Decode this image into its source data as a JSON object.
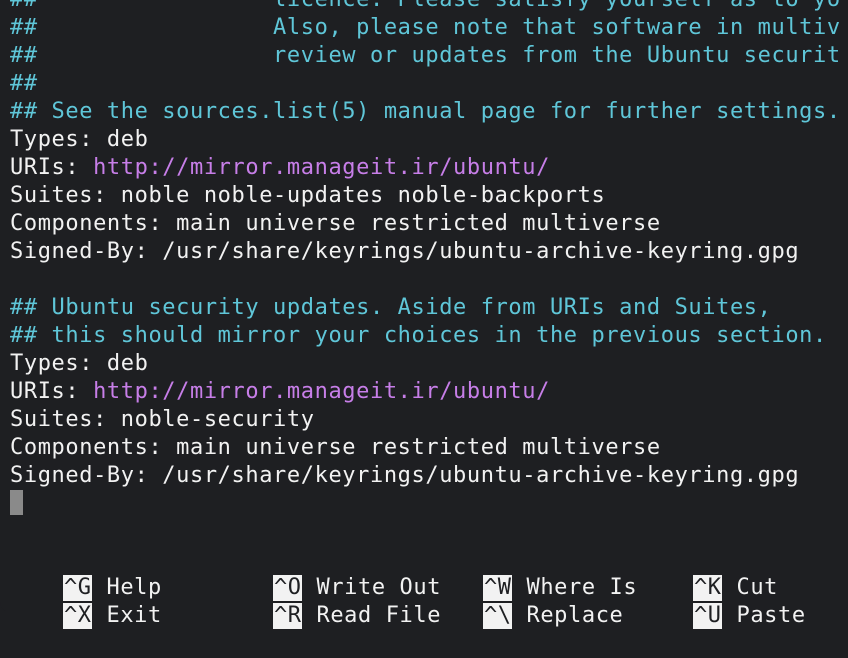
{
  "editor": {
    "lines": [
      {
        "text": "##                 licence. Please satisfy yourself as to yo",
        "kind": "comment"
      },
      {
        "text": "##                 Also, please note that software in multiv",
        "kind": "comment"
      },
      {
        "text": "##                 review or updates from the Ubuntu securit",
        "kind": "comment"
      },
      {
        "text": "##",
        "kind": "comment"
      },
      {
        "text": "## See the sources.list(5) manual page for further settings.",
        "kind": "comment"
      }
    ],
    "block1": {
      "types": "Types: deb",
      "uris_key": "URIs: ",
      "uris_value": "http://mirror.manageit.ir/ubuntu/",
      "suites": "Suites: noble noble-updates noble-backports",
      "components": "Components: main universe restricted multiverse",
      "signed_by": "Signed-By: /usr/share/keyrings/ubuntu-archive-keyring.gpg"
    },
    "comment2_line1": "## Ubuntu security updates. Aside from URIs and Suites,",
    "comment2_line2": "## this should mirror your choices in the previous section.",
    "block2": {
      "types": "Types: deb",
      "uris_key": "URIs: ",
      "uris_value": "http://mirror.manageit.ir/ubuntu/",
      "suites": "Suites: noble-security",
      "components": "Components: main universe restricted multiverse",
      "signed_by": "Signed-By: /usr/share/keyrings/ubuntu-archive-keyring.gpg"
    }
  },
  "shortcuts": {
    "help": {
      "key": "^G",
      "label": "Help"
    },
    "write_out": {
      "key": "^O",
      "label": "Write Out"
    },
    "where_is": {
      "key": "^W",
      "label": "Where Is"
    },
    "cut": {
      "key": "^K",
      "label": "Cut"
    },
    "exit": {
      "key": "^X",
      "label": "Exit"
    },
    "read_file": {
      "key": "^R",
      "label": "Read File"
    },
    "replace": {
      "key": "^\\",
      "label": "Replace"
    },
    "paste": {
      "key": "^U",
      "label": "Paste"
    }
  },
  "colors": {
    "background": "#1e1f22",
    "comment": "#5fc6d8",
    "url": "#c77ee8",
    "text": "#f2f2f2"
  }
}
